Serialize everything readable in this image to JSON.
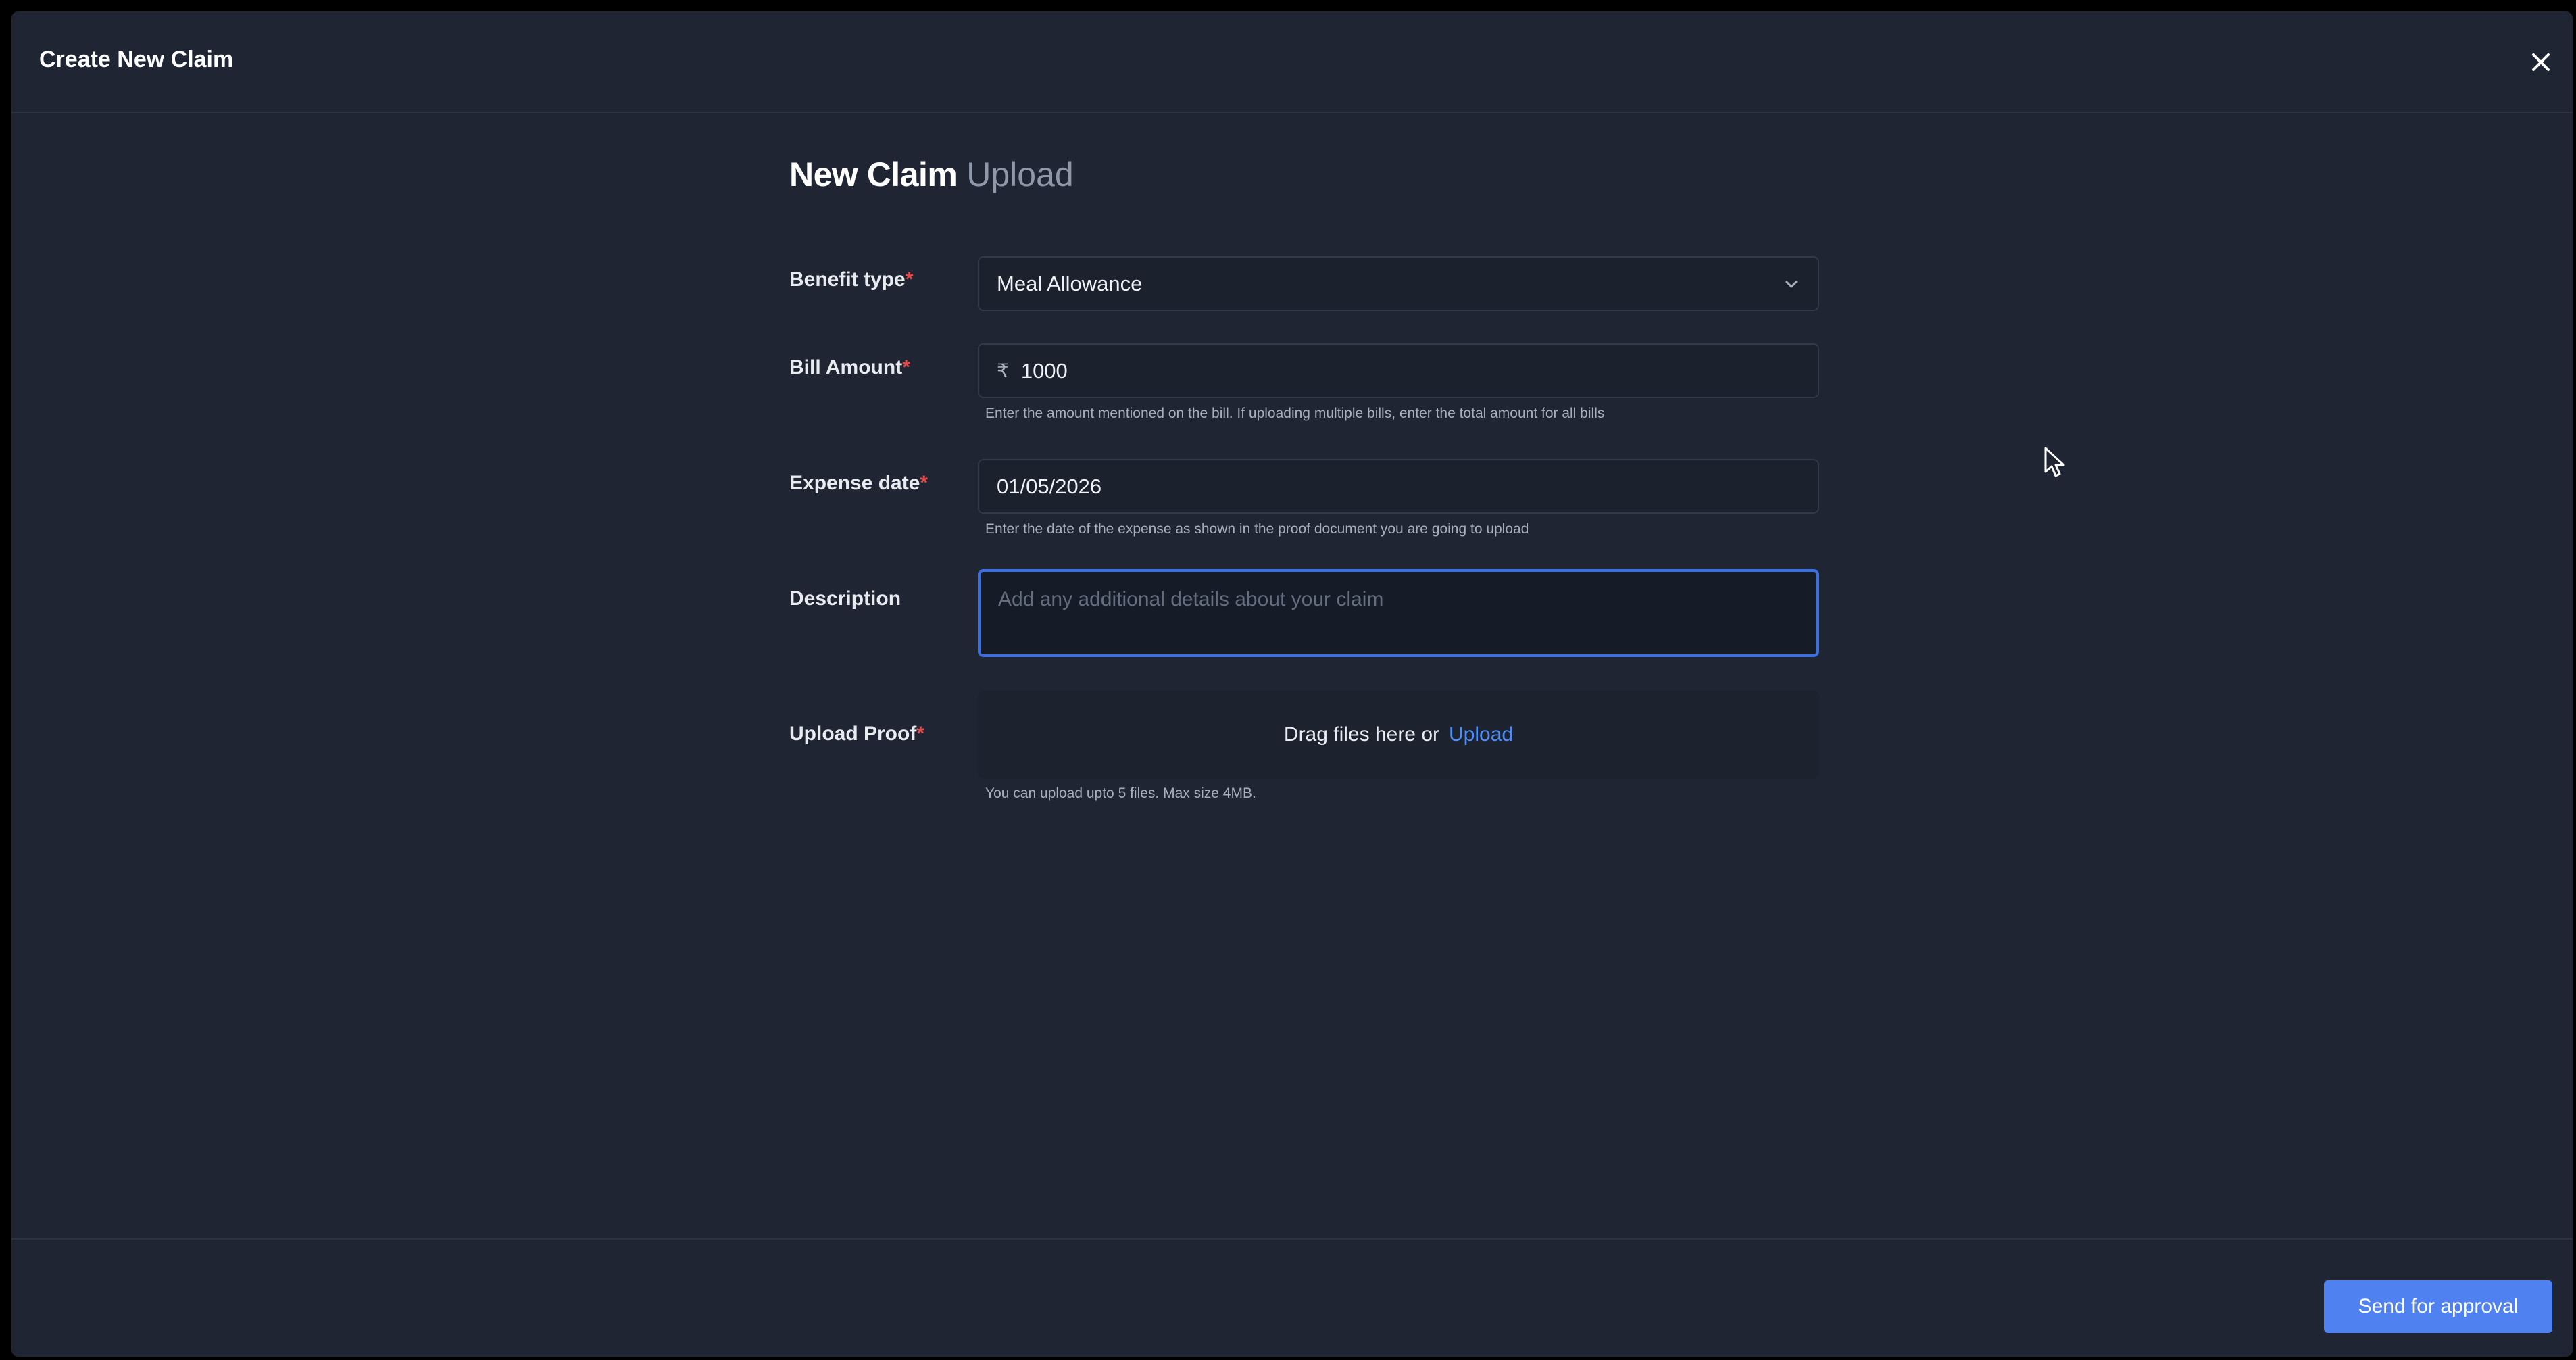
{
  "modal": {
    "title": "Create New Claim",
    "close_icon": "close-icon"
  },
  "form": {
    "title_main": "New Claim",
    "title_sub": "Upload",
    "benefit_type": {
      "label": "Benefit type",
      "required_mark": "*",
      "value": "Meal Allowance",
      "icon": "chevron-down-icon"
    },
    "bill_amount": {
      "label": "Bill Amount",
      "required_mark": "*",
      "currency_symbol": "₹",
      "value": "1000",
      "hint": "Enter the amount mentioned on the bill. If uploading multiple bills, enter the total amount for all bills"
    },
    "expense_date": {
      "label": "Expense date",
      "required_mark": "*",
      "value": "01/05/2026",
      "hint": "Enter the date of the expense as shown in the proof document you are going to upload"
    },
    "description": {
      "label": "Description",
      "placeholder": "Add any additional details about your claim"
    },
    "upload_proof": {
      "label": "Upload Proof",
      "required_mark": "*",
      "drag_text": "Drag files here or",
      "upload_link": "Upload",
      "hint": "You can upload upto 5 files. Max size 4MB."
    }
  },
  "footer": {
    "send_label": "Send for approval"
  },
  "colors": {
    "background": "#1f2533",
    "accent": "#4f82f0",
    "focus_border": "#3b6fe0",
    "required": "#e24c4c"
  }
}
